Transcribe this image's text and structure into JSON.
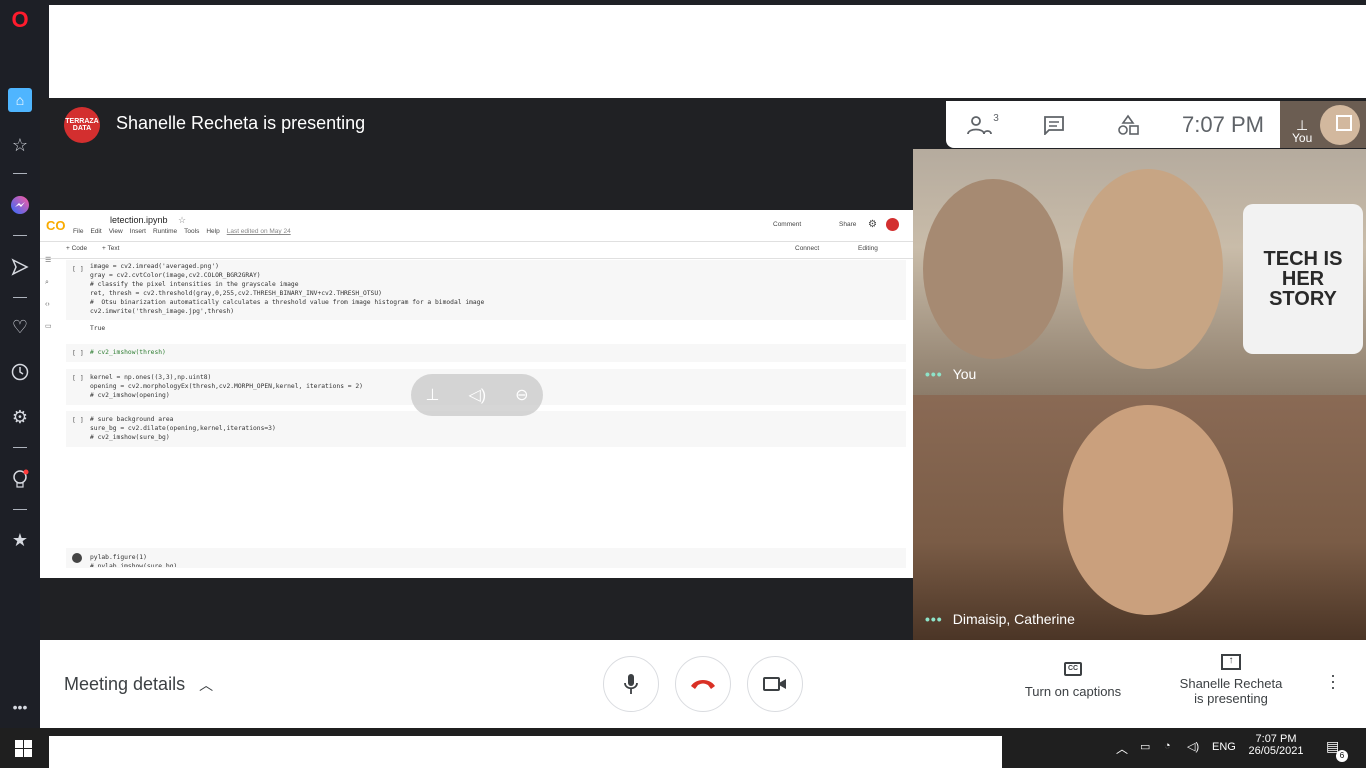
{
  "sidebar": {
    "icons": [
      "opera-logo-icon",
      "home-icon",
      "star-icon",
      "messenger-icon",
      "send-icon",
      "heart-icon",
      "history-icon",
      "settings-icon",
      "lightbulb-icon",
      "bookmark-star-icon",
      "more-icon"
    ]
  },
  "meet": {
    "presenting_title": "Shanelle Recheta is presenting",
    "presenter_logo_text": "TERRAZA DATA",
    "participants_count": "3",
    "time": "7:07  PM",
    "self_label": "You",
    "tiles": [
      {
        "name": "You"
      },
      {
        "name": "Dimaisip, Catherine"
      }
    ],
    "mug_text": "TECH IS HER STORY",
    "bottom": {
      "meeting_details": "Meeting details",
      "captions": "Turn on captions",
      "presenting_line1": "Shanelle Recheta",
      "presenting_line2": "is presenting"
    },
    "overlay_icons": [
      "pin-icon",
      "mute-icon",
      "remove-icon"
    ]
  },
  "colab": {
    "filename": "letection.ipynb",
    "menu": [
      "File",
      "Edit",
      "View",
      "Insert",
      "Runtime",
      "Tools",
      "Help"
    ],
    "last_edited": "Last edited on May 24",
    "comment": "Comment",
    "share": "Share",
    "add_code": "+ Code",
    "add_text": "+ Text",
    "connect": "Connect",
    "editing": "Editing",
    "cell1": "image = cv2.imread('averaged.png')\ngray = cv2.cvtColor(image,cv2.COLOR_BGR2GRAY)\n# classify the pixel intensities in the grayscale image\nret, thresh = cv2.threshold(gray,0,255,cv2.THRESH_BINARY_INV+cv2.THRESH_OTSU)\n#  Otsu binarization automatically calculates a threshold value from image histogram for a bimodal image\ncv2.imwrite('thresh_image.jpg',thresh)",
    "cell1_out": "True",
    "cell2": "# cv2_imshow(thresh)",
    "cell3": "kernel = np.ones((3,3),np.uint8)\nopening = cv2.morphologyEx(thresh,cv2.MORPH_OPEN,kernel, iterations = 2)\n# cv2_imshow(opening)",
    "cell4": "# sure background area\nsure_bg = cv2.dilate(opening,kernel,iterations=3)\n# cv2_imshow(sure_bg)",
    "cell5": "pylab.figure(1)\n# pylab.imshow(sure_bg)",
    "bracket": "[ ]"
  },
  "taskbar": {
    "time": "7:07 PM",
    "date": "26/05/2021",
    "lang": "ENG",
    "notif_count": "6"
  }
}
